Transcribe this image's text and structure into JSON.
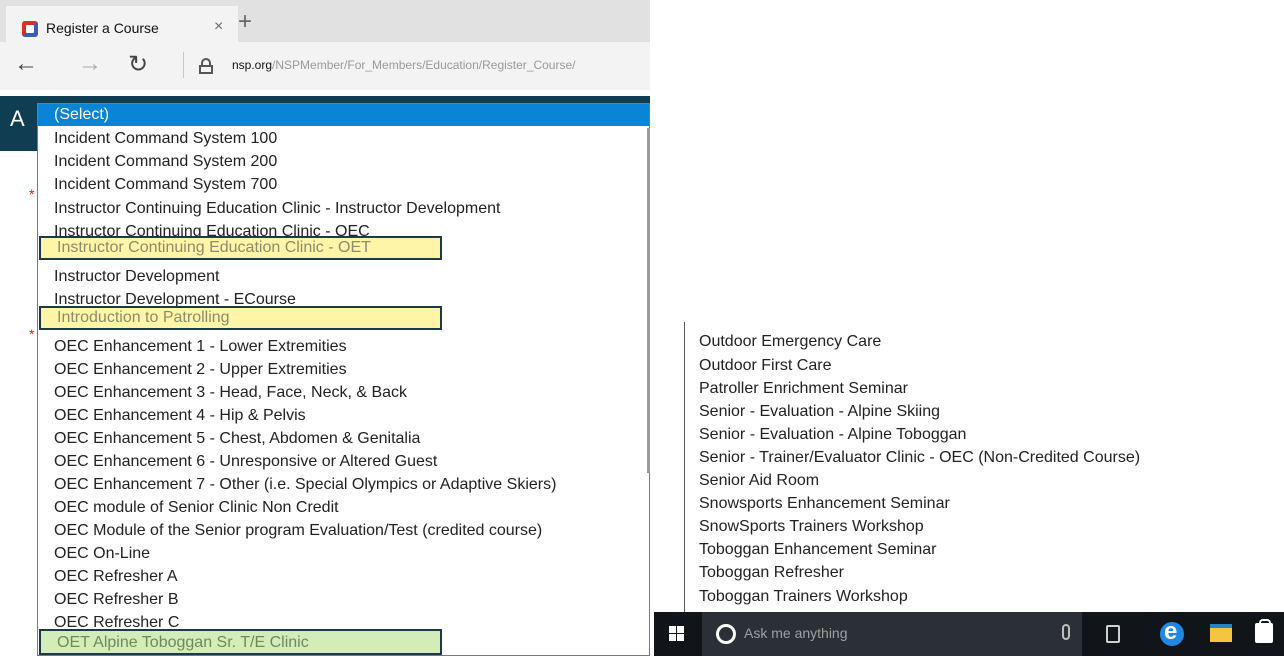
{
  "browser": {
    "tab_title": "Register a Course",
    "tab_close": "×",
    "new_tab": "+",
    "nav_back": "←",
    "nav_forward": "→",
    "nav_refresh": "↻",
    "url_host": "nsp.org",
    "url_path": "/NSPMember/For_Members/Education/Register_Course/"
  },
  "page": {
    "header_letter": "A",
    "required_mark": "*"
  },
  "dropdown": {
    "selected": "(Select)",
    "options": [
      "Incident Command System 100",
      "Incident Command System 200",
      "Incident Command System 700",
      "Instructor Continuing Education Clinic - Instructor Development",
      "Instructor Continuing Education Clinic - OEC",
      "Instructor Continuing Education Clinic - OET",
      "Instructor Development",
      "Instructor Development - ECourse",
      "Introduction to Patrolling",
      "OEC Enhancement 1 - Lower Extremities",
      "OEC Enhancement 2 - Upper Extremities",
      "OEC Enhancement 3 - Head, Face, Neck, & Back",
      "OEC Enhancement 4 - Hip & Pelvis",
      "OEC Enhancement 5 - Chest, Abdomen & Genitalia",
      "OEC Enhancement 6 - Unresponsive or Altered Guest",
      "OEC Enhancement 7 - Other (i.e. Special Olympics or Adaptive Skiers)",
      "OEC module of Senior Clinic Non Credit",
      "OEC Module of the Senior program Evaluation/Test (credited course)",
      "OEC On-Line",
      "OEC Refresher A",
      "OEC Refresher B",
      "OEC Refresher C",
      "OET Alpine Toboggan Sr. T/E Clinic"
    ],
    "highlight_colors": {
      "yellow": "#fff5a8",
      "green": "#d3ecb9",
      "selected": "#0a84d6"
    }
  },
  "dropdown_continued": {
    "options": [
      "Outdoor Emergency Care",
      "Outdoor First Care",
      "Patroller Enrichment Seminar",
      "Senior - Evaluation - Alpine Skiing",
      "Senior - Evaluation - Alpine Toboggan",
      "Senior - Trainer/Evaluator Clinic - OEC (Non-Credited Course)",
      "Senior Aid Room",
      "Snowsports Enhancement Seminar",
      "SnowSports Trainers Workshop",
      "Toboggan Enhancement Seminar",
      "Toboggan Refresher",
      "Toboggan Trainers Workshop"
    ]
  },
  "taskbar": {
    "search_placeholder": "Ask me anything",
    "icons": [
      "windows-icon",
      "cortana-icon",
      "microphone-icon",
      "task-view-icon",
      "edge-icon",
      "file-explorer-icon",
      "store-icon"
    ]
  }
}
